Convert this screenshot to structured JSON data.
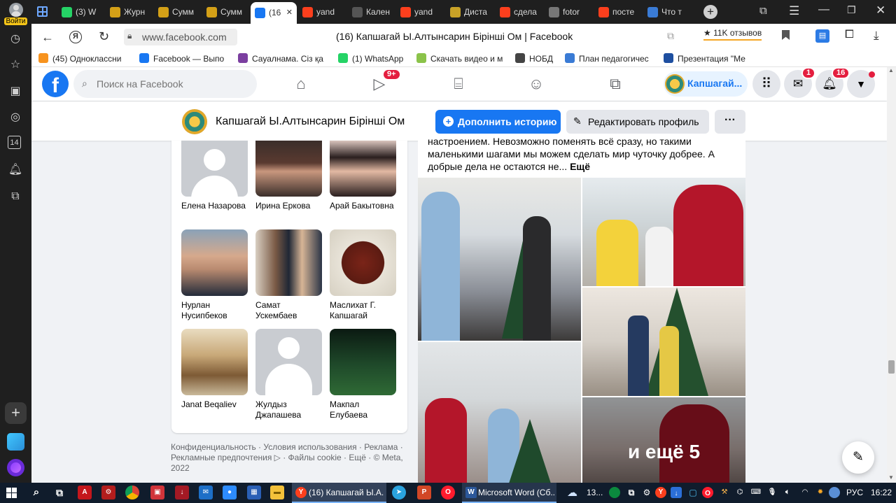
{
  "sidebar": {
    "login_label": "Войти",
    "calendar_day": "14"
  },
  "tabs": [
    {
      "label": "(3) W",
      "icon": "whatsapp-icon",
      "color": "#25d366"
    },
    {
      "label": "Журн",
      "icon": "hand-icon",
      "color": "#d4a017"
    },
    {
      "label": "Сумм",
      "icon": "hand-icon",
      "color": "#d4a017"
    },
    {
      "label": "Сумм",
      "icon": "hand-icon",
      "color": "#d4a017"
    },
    {
      "label": "(16",
      "icon": "facebook-icon",
      "color": "#1877f2",
      "active": true
    },
    {
      "label": "yand",
      "icon": "yandex-icon",
      "color": "#fc3f1d"
    },
    {
      "label": "Кален",
      "icon": "calendar-icon",
      "color": "#555555"
    },
    {
      "label": "yand",
      "icon": "yandex-icon",
      "color": "#fc3f1d"
    },
    {
      "label": "Диста",
      "icon": "emblem-icon",
      "color": "#c9a227"
    },
    {
      "label": "сдела",
      "icon": "yandex-icon",
      "color": "#fc3f1d"
    },
    {
      "label": "fotor",
      "icon": "document-icon",
      "color": "#777777"
    },
    {
      "label": "посте",
      "icon": "yandex-icon",
      "color": "#fc3f1d"
    },
    {
      "label": "Что т",
      "icon": "mail-icon",
      "color": "#3a7bd5"
    }
  ],
  "address": {
    "url": "www.facebook.com",
    "page_title": "(16) Капшагай Ы.Алтынсарин Бірінші Ом | Facebook",
    "reviews": "★ 11K отзывов"
  },
  "bookmarks": [
    {
      "label": "(45) Одноклассни",
      "color": "#f7931e"
    },
    {
      "label": "Facebook — Выпо",
      "color": "#1877f2"
    },
    {
      "label": "Сауалнама. Сіз қа",
      "color": "#7b3fa0"
    },
    {
      "label": "(1) WhatsApp",
      "color": "#25d366"
    },
    {
      "label": "Скачать видео и м",
      "color": "#8bc34a"
    },
    {
      "label": "НОБД",
      "color": "#444444"
    },
    {
      "label": "План педагогичес",
      "color": "#3a7bd5"
    },
    {
      "label": "Презентация \"Ме",
      "color": "#1e4fa0"
    }
  ],
  "fb": {
    "search_placeholder": "Поиск на Facebook",
    "watch_badge": "9+",
    "profile_short": "Капшагай...",
    "messenger_badge": "1",
    "notif_badge": "16"
  },
  "profile": {
    "name": "Капшагай Ы.Алтынсарин Бірінші Ом",
    "add_story": "Дополнить историю",
    "edit_profile": "Редактировать профиль",
    "more": "···"
  },
  "friends": [
    {
      "name": "Елена Назарова",
      "photo": "silhouette"
    },
    {
      "name": "Ирина Еркова",
      "photo": "woman"
    },
    {
      "name": "Арай Бакытовна",
      "photo": "woman2"
    },
    {
      "name": "Нурлан Нусипбеков",
      "photo": "man"
    },
    {
      "name": "Самат Ускембаев",
      "photo": "men"
    },
    {
      "name": "Маслихат Г. Капшагай",
      "photo": "book"
    },
    {
      "name": "Janat Beqaliev",
      "photo": "office"
    },
    {
      "name": "Жулдыз Джапашева",
      "photo": "silhouette"
    },
    {
      "name": "Макпал Елубаева",
      "photo": "night"
    }
  ],
  "footer": "Конфиденциальность · Условия использования · Реклама · Рекламные предпочтения ▷ · Файлы cookie · Ещё · © Meta, 2022",
  "post": {
    "text_line1": "настроением. Невозможно поменять всё сразу, но такими",
    "text_line2": "маленькими шагами мы можем сделать мир чуточку добрее. А",
    "text_line3": "добрые дела не остаются не...",
    "more": "Ещё",
    "more_photos": "и ещё 5"
  },
  "taskbar": {
    "fb_task": "(16) Капшагай Ы.А...",
    "word_task": "Microsoft Word (Сб...",
    "weather": "13...",
    "lang": "РУС",
    "time": "16:22"
  },
  "colors": {
    "fb_blue": "#1877f2",
    "badge_red": "#e41e3f",
    "taskbar": "#101c2c"
  }
}
